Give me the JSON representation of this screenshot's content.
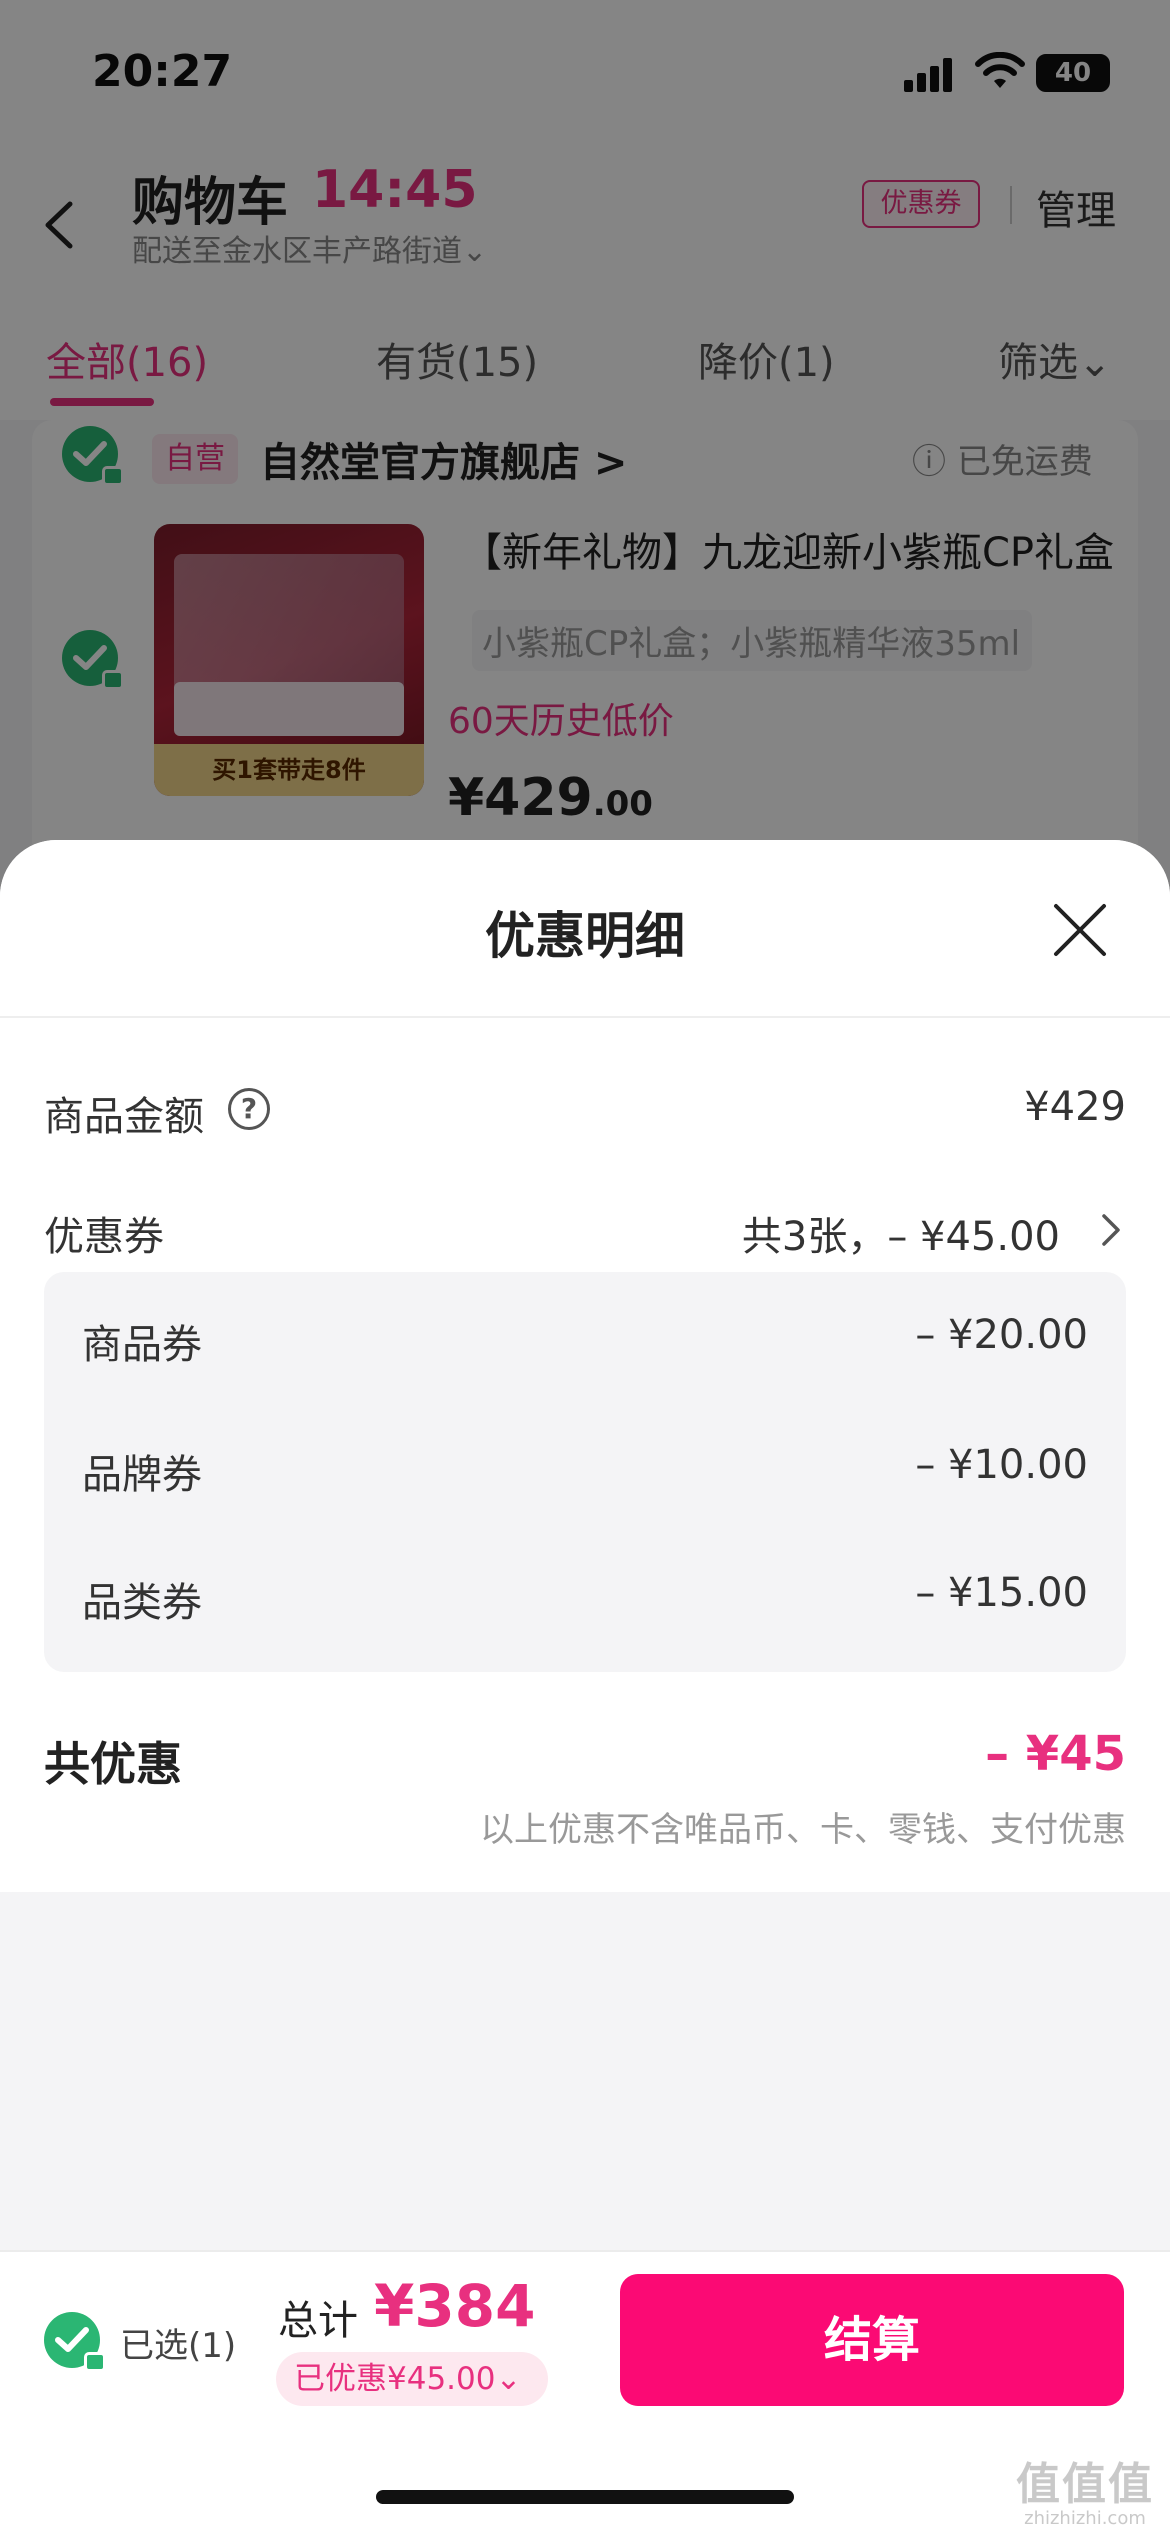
{
  "status_bar": {
    "time": "20:27",
    "battery": "40"
  },
  "header": {
    "title": "购物车",
    "timer": "14:45",
    "address": "配送至金水区丰产路街道⌄",
    "coupon_badge": "优惠券",
    "manage": "管理"
  },
  "tabs": [
    {
      "label": "全部(16)",
      "active": true
    },
    {
      "label": "有货(15)",
      "active": false
    },
    {
      "label": "降价(1)",
      "active": false
    },
    {
      "label": "筛选⌄",
      "active": false
    }
  ],
  "store": {
    "self_tag": "自营",
    "name": "自然堂官方旗舰店 >",
    "shipping": "已免运费",
    "product": {
      "title": "【新年礼物】九龙迎新小紫瓶CP礼盒",
      "spec": "小紫瓶CP礼盒；小紫瓶精华液35ml",
      "history_low": "60天历史低价",
      "price_int": "¥429",
      "price_dec": ".00",
      "image_banner": "买1套带走8件"
    }
  },
  "sheet": {
    "title": "优惠明细",
    "goods_amount_label": "商品金额",
    "goods_amount_value": "¥429",
    "coupon_label": "优惠券",
    "coupon_summary": "共3张，– ¥45.00",
    "coupons": [
      {
        "label": "商品券",
        "value": "– ¥20.00"
      },
      {
        "label": "品牌券",
        "value": "– ¥10.00"
      },
      {
        "label": "品类券",
        "value": "– ¥15.00"
      }
    ],
    "total_discount_label": "共优惠",
    "total_discount_value": "– ¥45",
    "note": "以上优惠不含唯品币、卡、零钱、支付优惠"
  },
  "bottom_bar": {
    "selected": "已选(1)",
    "total_label": "总计",
    "total_value": "¥384",
    "saved": "已优惠¥45.00⌄",
    "checkout": "结算"
  },
  "watermark": {
    "logo": "值值值",
    "url": "zhizhizhi.com"
  },
  "colors": {
    "accent": "#e8307f",
    "checkout": "#fb0a74",
    "check_green": "#2bb673"
  }
}
